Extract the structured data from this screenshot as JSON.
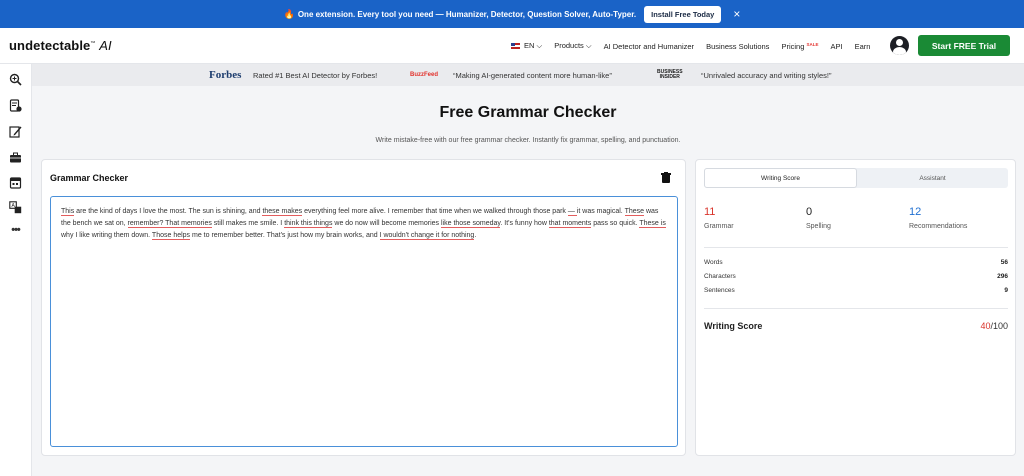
{
  "banner": {
    "text": "One extension. Every tool you need — Humanizer, Detector, Question Solver, Auto-Typer.",
    "button": "Install Free Today",
    "close": "×"
  },
  "header": {
    "logo_main": "undetectable",
    "logo_ai": "AI",
    "nav": {
      "lang": "EN",
      "products": "Products",
      "ai_detector": "AI Detector and Humanizer",
      "business": "Business Solutions",
      "pricing": "Pricing",
      "sale": "SALE",
      "api": "API",
      "earn": "Earn"
    },
    "cta": "Start FREE Trial"
  },
  "press": {
    "forbes": "Forbes",
    "forbes_quote": "Rated #1 Best AI Detector by Forbes!",
    "buzzfeed": "BuzzFeed",
    "buzzfeed_quote": "“Making AI-generated content more human-like”",
    "bi_line1": "BUSINESS",
    "bi_line2": "INSIDER",
    "bi_quote": "“Unrivaled accuracy and writing styles!”"
  },
  "page": {
    "title": "Free Grammar Checker",
    "subtitle": "Write mistake-free with our free grammar checker. Instantly fix grammar, spelling, and punctuation."
  },
  "editor": {
    "title": "Grammar Checker",
    "segments": [
      {
        "t": "This",
        "err": true
      },
      {
        "t": " are the kind of days I love the most. The sun is shining, and ",
        "err": false
      },
      {
        "t": "these makes",
        "err": true
      },
      {
        "t": " everything feel more alive. I remember that time when we walked through those park ",
        "err": false
      },
      {
        "t": " — ",
        "err": true
      },
      {
        "t": " it was magical. ",
        "err": false
      },
      {
        "t": "These",
        "err": true
      },
      {
        "t": " was the bench we sat on, ",
        "err": false
      },
      {
        "t": "remember? That memories",
        "err": true
      },
      {
        "t": " still makes me smile. I ",
        "err": false
      },
      {
        "t": "think this things",
        "err": true
      },
      {
        "t": " we do now will become memories ",
        "err": false
      },
      {
        "t": "like those someday",
        "err": true
      },
      {
        "t": ". It's funny how ",
        "err": false
      },
      {
        "t": "that moments",
        "err": true
      },
      {
        "t": " pass so quick. ",
        "err": false
      },
      {
        "t": "These is",
        "err": true
      },
      {
        "t": " why I like writing them down. ",
        "err": false
      },
      {
        "t": "Those helps",
        "err": true
      },
      {
        "t": " me to remember better. That's just how my brain works, and ",
        "err": false
      },
      {
        "t": "I wouldn't change it for nothing",
        "err": true
      },
      {
        "t": ".",
        "err": false
      }
    ]
  },
  "score": {
    "tabs": [
      "Writing Score",
      "Assistant"
    ],
    "grammar": {
      "value": "11",
      "label": "Grammar"
    },
    "spelling": {
      "value": "0",
      "label": "Spelling"
    },
    "recommendations": {
      "value": "12",
      "label": "Recommendations"
    },
    "stats": [
      {
        "label": "Words",
        "value": "56"
      },
      {
        "label": "Characters",
        "value": "296"
      },
      {
        "label": "Sentences",
        "value": "9"
      }
    ],
    "writing_score_label": "Writing Score",
    "writing_score_value": "40",
    "writing_score_total": "/100"
  },
  "colors": {
    "banner": "#1a63c7",
    "cta": "#1a8a35",
    "error": "#d9342b",
    "accent_blue": "#1f6fd1"
  },
  "icons": [
    "fire-icon",
    "close-icon",
    "us-flag-icon",
    "chevron-down-icon",
    "user-avatar-icon",
    "magnifier-icon",
    "document-check-icon",
    "pen-icon",
    "briefcase-icon",
    "calendar-icon",
    "translate-icon",
    "more-icon",
    "trash-icon"
  ]
}
